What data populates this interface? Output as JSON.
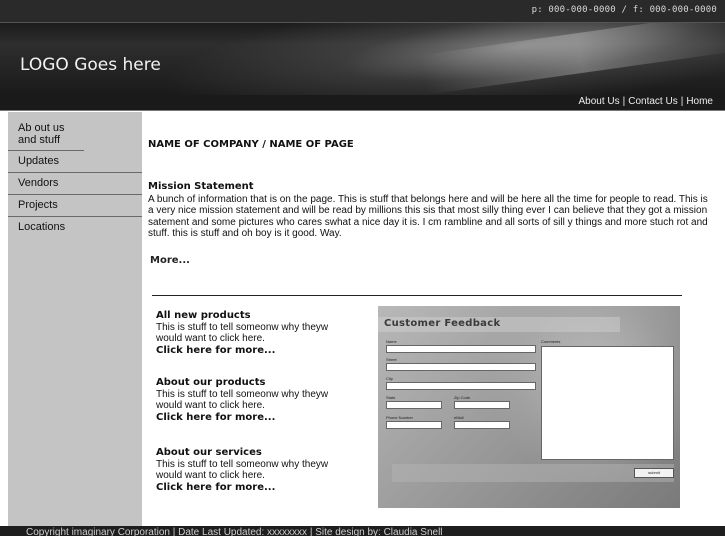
{
  "header": {
    "contact": "p: 000-000-0000 / f: 000-000-0000",
    "logo": "LOGO Goes here"
  },
  "topnav": {
    "items": [
      {
        "label": "About Us"
      },
      {
        "label": "Contact Us"
      },
      {
        "label": "Home"
      }
    ],
    "separator": "|"
  },
  "sidebar": {
    "items": [
      {
        "label_line1": "Ab out us",
        "label_line2": "and stuff"
      },
      {
        "label": "Updates"
      },
      {
        "label": "Vendors"
      },
      {
        "label": "Projects"
      },
      {
        "label": "Locations"
      }
    ]
  },
  "main": {
    "title": "NAME OF COMPANY / NAME OF PAGE",
    "mission": {
      "heading": "Mission Statement",
      "body": "A bunch of information that is on the page. This is stuff that belongs here and will be here all the time for people to read. This is a very nice mission statement and will be read by  millions this sis that most silly thing ever I can believe that they got a mission satement and some pictures who cares swhat a nice day it is. I cm rambline and all sorts of sill y things and more stuch rot and stuff. this is stuff and oh boy is it good. Way."
    },
    "more": "More...",
    "promos": [
      {
        "heading": "All new products",
        "body": "This is stuff to tell someonw why theyw would want to click here.",
        "link": "Click here for more..."
      },
      {
        "heading": "About our products",
        "body": "This is stuff to tell someonw why theyw would want to click here.",
        "link": "Click here for more..."
      },
      {
        "heading": "About our services",
        "body": "This is stuff to tell someonw why theyw would want to click here.",
        "link": "Click here for more..."
      }
    ]
  },
  "feedback": {
    "title": "Customer Feedback",
    "fields": {
      "name": "Name",
      "street": "Street",
      "city": "City",
      "state": "State",
      "zip": "Zip Code",
      "phone": "Phone Number",
      "email": "eMail",
      "comments": "Comments"
    },
    "submit": "submit"
  },
  "footer": {
    "text": "Copyright imaginary Corporation | Date Last Updated: xxxxxxxx | Site design by: Claudia Snell"
  }
}
